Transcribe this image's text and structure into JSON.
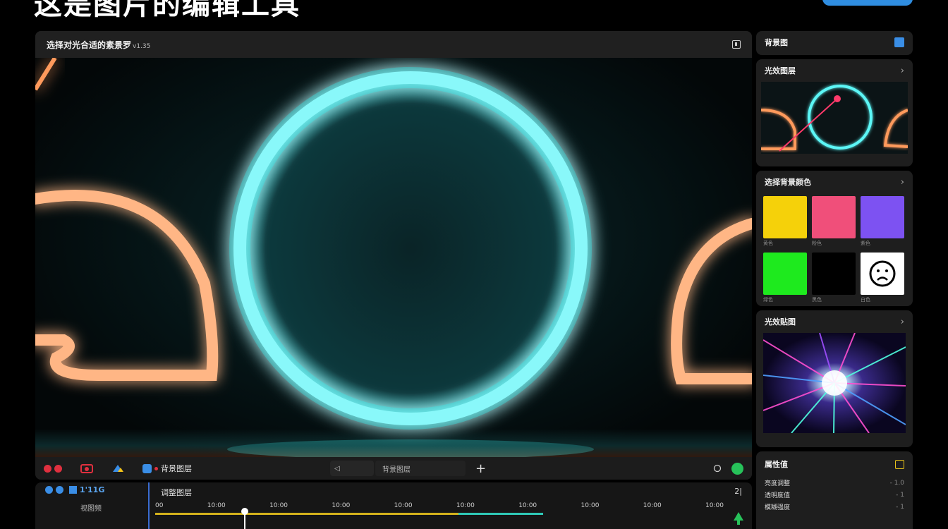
{
  "page": {
    "title": "这是图片的编辑工具",
    "top_button": ""
  },
  "editor": {
    "title": "选择对光合适的素景罗",
    "version": "v1.35",
    "toolbar": {
      "layer_label": "背景图层",
      "search_value": "",
      "field_value": "背景图层",
      "plus": "+"
    }
  },
  "timeline": {
    "left_label": "1'11G",
    "left_sub": "视图频",
    "track_title": "调整图层",
    "end_label": "2|",
    "ticks": [
      "00",
      "10:00",
      "10:00",
      "10:00",
      "10:00",
      "10:00",
      "10:00",
      "10:00",
      "10:00",
      "10:00"
    ]
  },
  "panels": {
    "header": {
      "title": "背景图"
    },
    "preview": {
      "title": "光效图层"
    },
    "colors": {
      "title": "选择背景颜色",
      "swatches": [
        {
          "color": "#f5d10a",
          "label": "黄色"
        },
        {
          "color": "#f04f7a",
          "label": "粉色"
        },
        {
          "color": "#7d52f2",
          "label": "紫色"
        },
        {
          "color": "#1eea1e",
          "label": "绿色"
        },
        {
          "color": "#000000",
          "label": "黑色"
        },
        {
          "color": "#ffffff",
          "label": "白色"
        }
      ]
    },
    "effects": {
      "title": "光效贴图"
    },
    "props": {
      "title": "属性值",
      "rows": [
        {
          "name": "亮度调整",
          "value": "- 1.0"
        },
        {
          "name": "透明度值",
          "value": "- 1"
        },
        {
          "name": "模糊强度",
          "value": "- 1"
        }
      ]
    }
  },
  "colors": {
    "neon_cyan": "#2ef2f2",
    "neon_orange": "#ffb07a",
    "accent_blue": "#2f8de0",
    "accent_green": "#27c25a"
  }
}
